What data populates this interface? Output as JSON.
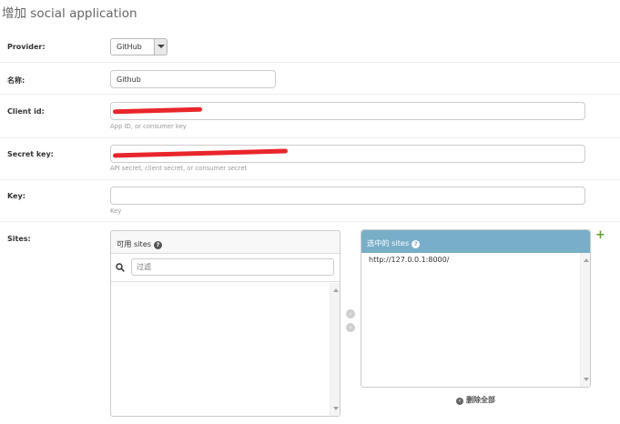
{
  "page": {
    "title": "增加 social application"
  },
  "provider": {
    "label": "Provider:",
    "value": "GitHub"
  },
  "name": {
    "label": "名称:",
    "value": "Github"
  },
  "client_id": {
    "label": "Client id:",
    "help": "App ID, or consumer key"
  },
  "secret_key": {
    "label": "Secret key:",
    "help": "API secret, client secret, or consumer secret"
  },
  "key": {
    "label": "Key:",
    "value": "",
    "help": "Key"
  },
  "sites": {
    "label": "Sites:",
    "available": {
      "title": "可用 sites",
      "filter_placeholder": "过滤",
      "items": []
    },
    "chosen": {
      "title": "选中的 sites",
      "items": [
        "http://127.0.0.1:8000/"
      ]
    },
    "remove_all_label": "删除全部",
    "add_label": "+"
  },
  "colors": {
    "chosen_header_bg": "#79aec8",
    "add_plus": "#5fa02a",
    "redaction": "#e8262b"
  },
  "icons": [
    "chevron-down-icon",
    "help-icon",
    "search-icon",
    "arrow-right-icon",
    "arrow-left-icon",
    "remove-all-icon",
    "add-icon"
  ]
}
